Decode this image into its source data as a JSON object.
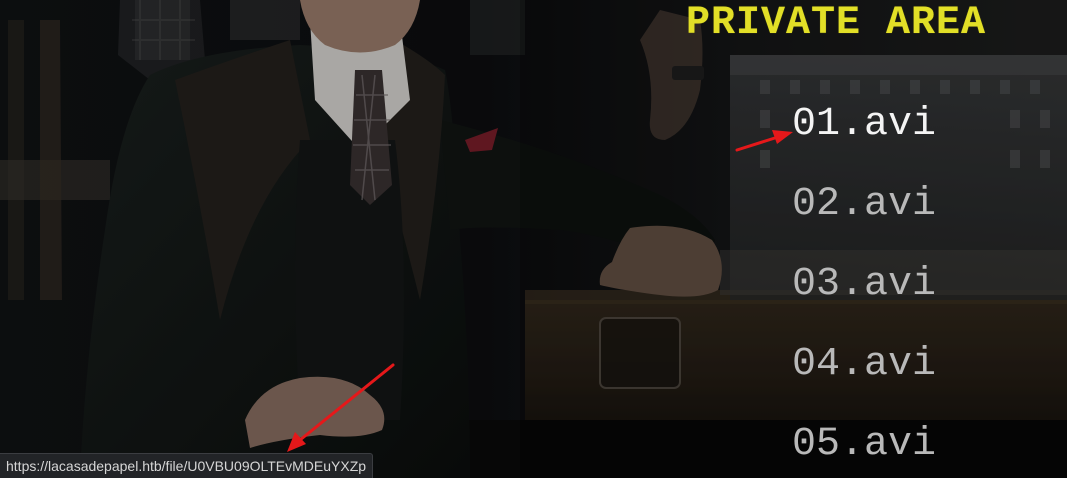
{
  "page": {
    "title": "PRIVATE AREA"
  },
  "files": [
    {
      "label": "01.avi",
      "highlighted": true
    },
    {
      "label": "02.avi",
      "highlighted": false
    },
    {
      "label": "03.avi",
      "highlighted": false
    },
    {
      "label": "04.avi",
      "highlighted": false
    },
    {
      "label": "05.avi",
      "highlighted": false
    }
  ],
  "status_bar": {
    "url": "https://lacasadepapel.htb/file/U0VBU09OLTEvMDEuYXZp"
  },
  "colors": {
    "title": "#e2df27",
    "link": "#b9b9b9",
    "link_highlighted": "#f4f4f4",
    "annotation_arrow": "#e5181a",
    "background": "#0b0b0b"
  }
}
